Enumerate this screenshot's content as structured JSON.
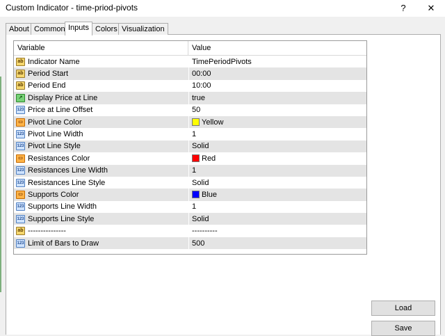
{
  "window": {
    "title": "Custom Indicator - time-priod-pivots",
    "help_label": "?",
    "close_label": "✕"
  },
  "tabs": [
    {
      "label": "About",
      "active": false
    },
    {
      "label": "Common",
      "active": false
    },
    {
      "label": "Inputs",
      "active": true
    },
    {
      "label": "Colors",
      "active": false
    },
    {
      "label": "Visualization",
      "active": false
    }
  ],
  "grid": {
    "headers": {
      "variable": "Variable",
      "value": "Value"
    },
    "rows": [
      {
        "icon": "ab-text-icon",
        "variable": "Indicator Name",
        "value": "TimePeriodPivots"
      },
      {
        "icon": "ab-text-icon",
        "variable": "Period Start",
        "value": "00:00"
      },
      {
        "icon": "ab-text-icon",
        "variable": "Period End",
        "value": "10:00"
      },
      {
        "icon": "bool-icon",
        "variable": "Display Price at Line",
        "value": "true"
      },
      {
        "icon": "number-icon",
        "variable": "Price at Line Offset",
        "value": "50"
      },
      {
        "icon": "color-icon",
        "variable": "Pivot Line Color",
        "value": "Yellow",
        "swatch": "#ffff00"
      },
      {
        "icon": "number-icon",
        "variable": "Pivot Line Width",
        "value": "1"
      },
      {
        "icon": "number-icon",
        "variable": "Pivot Line Style",
        "value": "Solid"
      },
      {
        "icon": "color-icon",
        "variable": "Resistances Color",
        "value": "Red",
        "swatch": "#ff0000"
      },
      {
        "icon": "number-icon",
        "variable": "Resistances Line Width",
        "value": "1"
      },
      {
        "icon": "number-icon",
        "variable": "Resistances Line Style",
        "value": "Solid"
      },
      {
        "icon": "color-icon",
        "variable": "Supports Color",
        "value": "Blue",
        "swatch": "#0000ff"
      },
      {
        "icon": "number-icon",
        "variable": "Supports Line Width",
        "value": "1"
      },
      {
        "icon": "number-icon",
        "variable": "Supports Line Style",
        "value": "Solid"
      },
      {
        "icon": "ab-text-icon",
        "variable": "---------------",
        "value": "----------"
      },
      {
        "icon": "number-icon",
        "variable": "Limit of Bars to Draw",
        "value": "500"
      }
    ]
  },
  "buttons": {
    "load_label": "Load",
    "save_label": "Save"
  }
}
